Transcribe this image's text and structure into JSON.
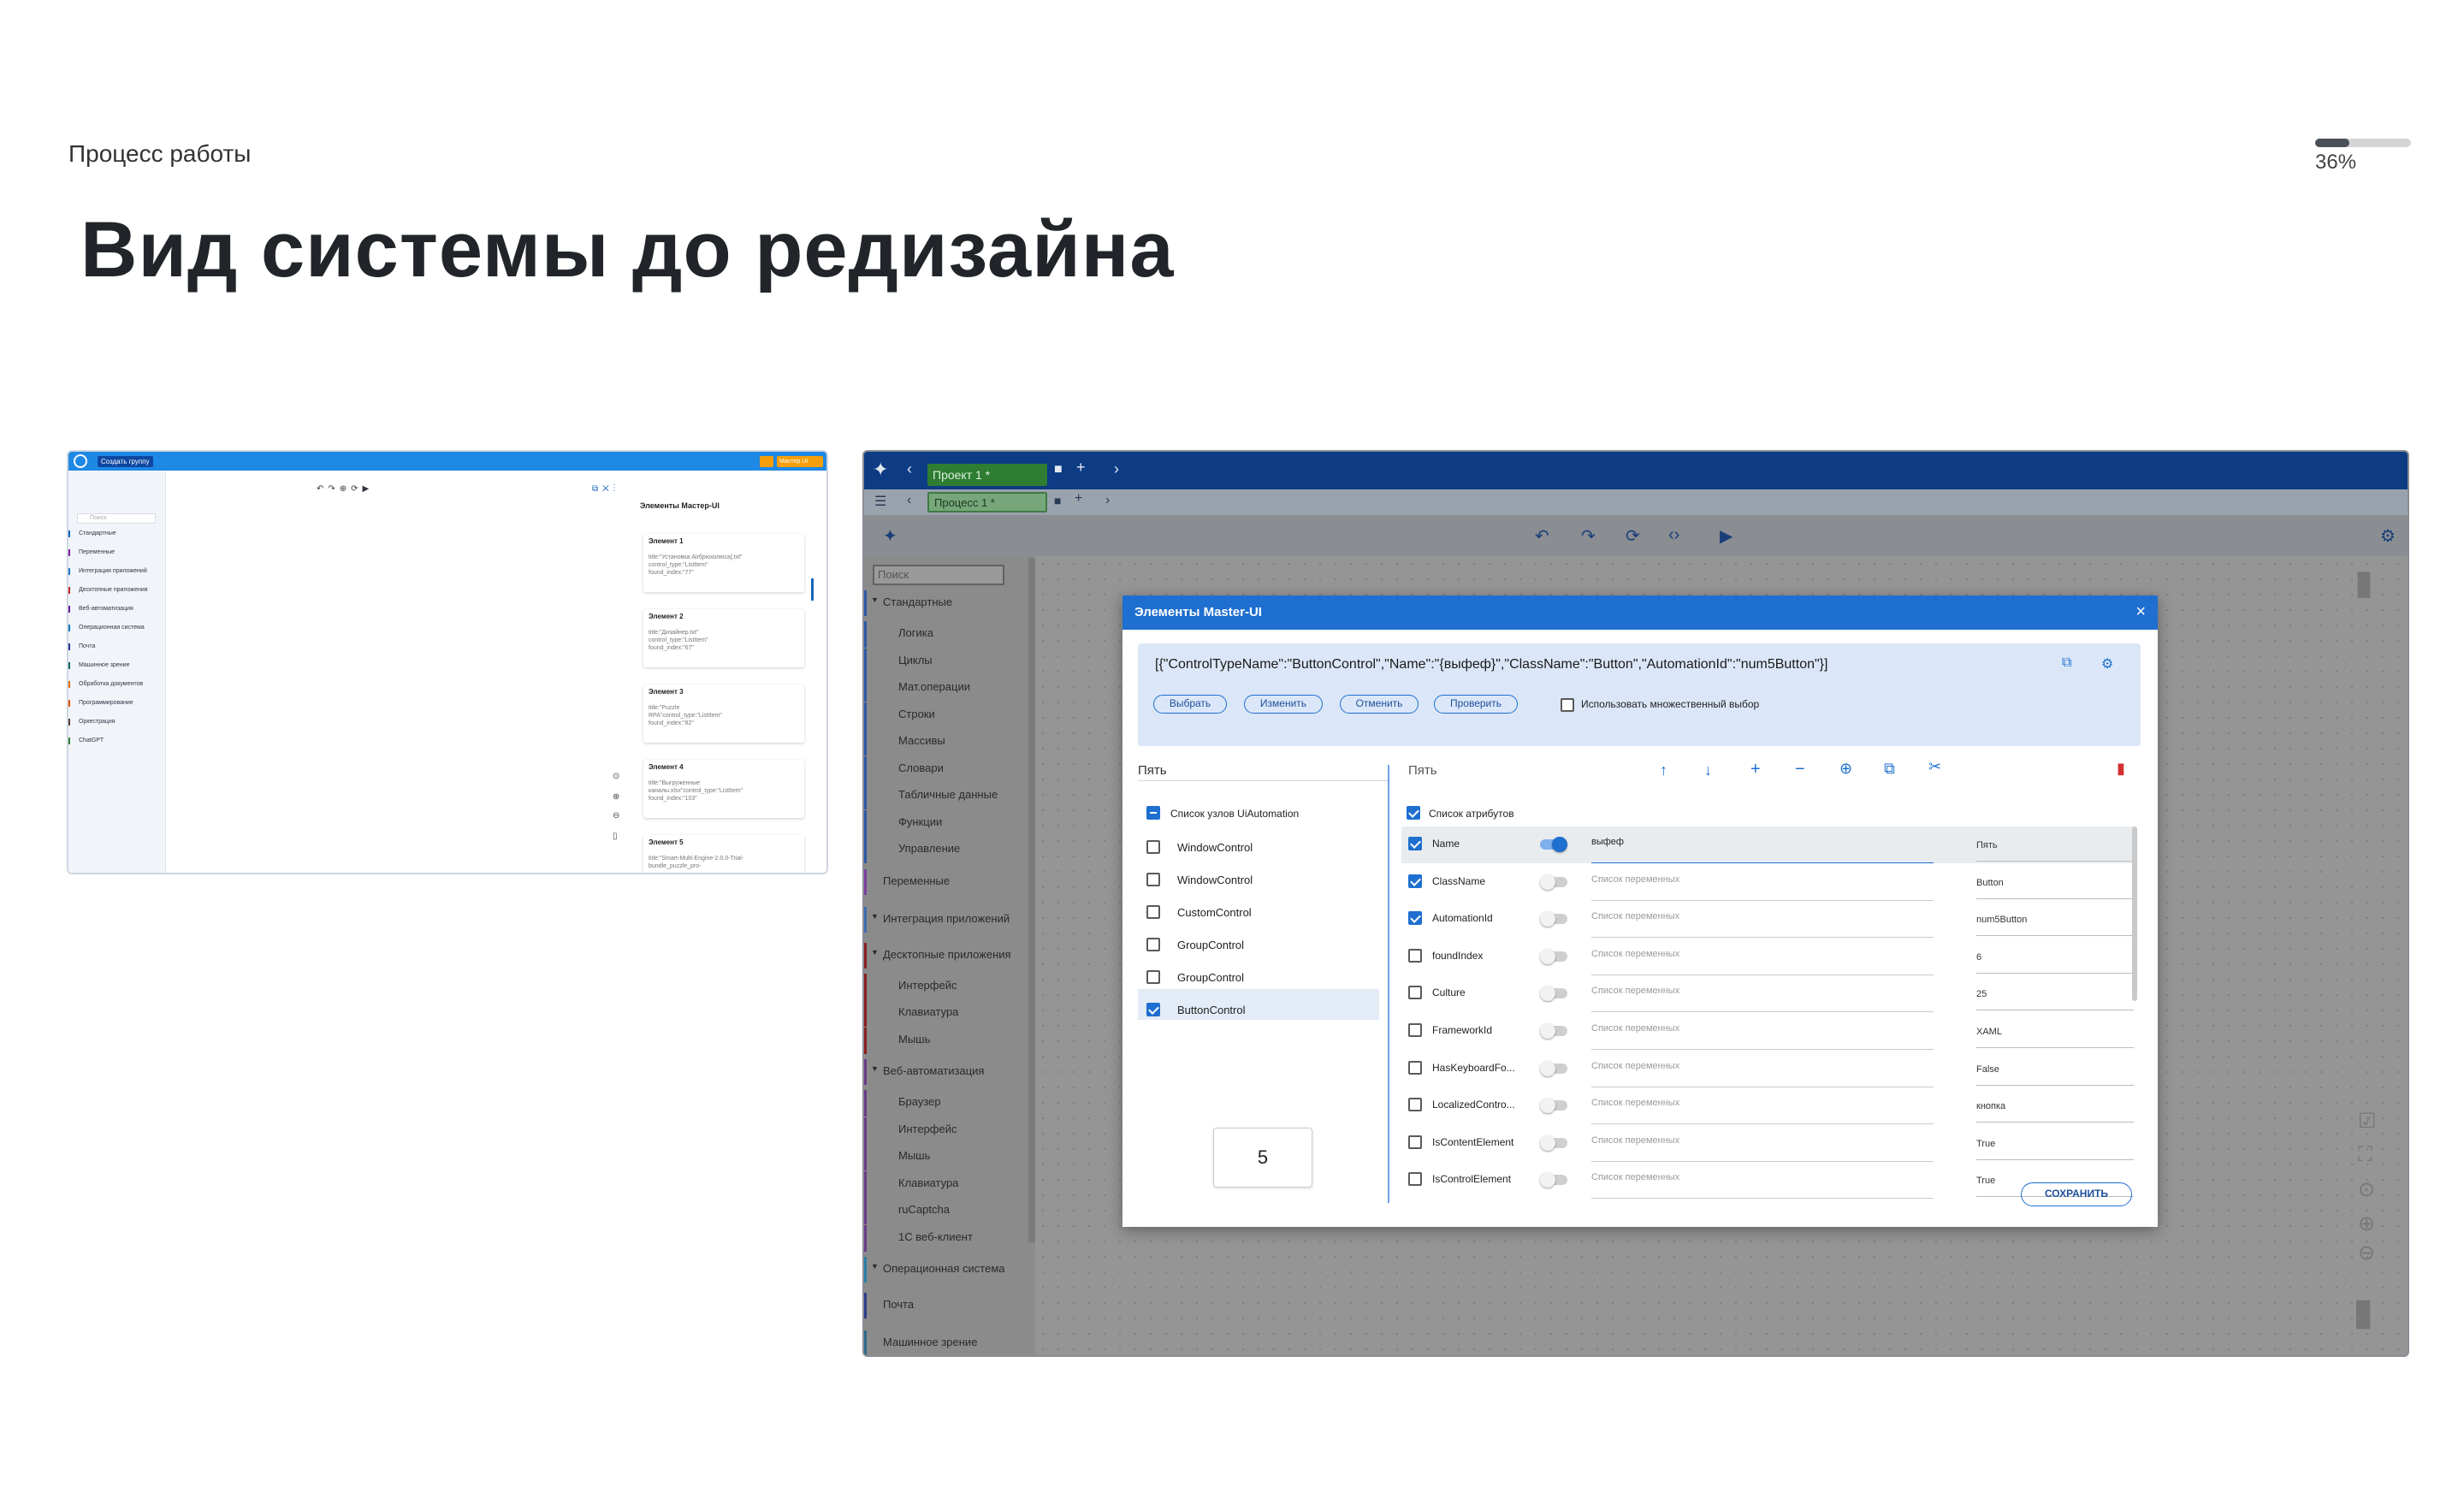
{
  "header": {
    "section": "Процесс работы",
    "title": "Вид системы до редизайна",
    "progress_value": 0.36,
    "progress_label": "36%"
  },
  "before_small": {
    "top_button": "Создать группу",
    "top_right_button": "Мастер UI",
    "search_placeholder": "Поиск",
    "categories": [
      "Стандартные",
      "Переменные",
      "Интеграция приложений",
      "Десктопные приложения",
      "Веб-автоматизация",
      "Операционная система",
      "Почта",
      "Машинное зрение",
      "Обработка документов",
      "Программирование",
      "Оркестрация",
      "ChatGPT"
    ],
    "panel_title": "Элементы Мастер-UI",
    "cards": [
      {
        "title": "Элемент 1",
        "lines": [
          "title:\"Установка Airбрюхолюса].txt\"",
          "control_type:\"ListItem\"",
          "found_index:\"77\""
        ]
      },
      {
        "title": "Элемент 2",
        "lines": [
          "title:\"Дизайнер.txt\"",
          "control_type:\"ListItem\"",
          "found_index:\"67\""
        ]
      },
      {
        "title": "Элемент 3",
        "lines": [
          "title:\"Puzzle",
          "RPA\"control_type:\"ListItem\"",
          "found_index:\"82\""
        ]
      },
      {
        "title": "Элемент 4",
        "lines": [
          "title:\"Выгруженные",
          "каналы.xlsx\"control_type:\"ListItem\"",
          "found_index:\"103\""
        ]
      },
      {
        "title": "Элемент 5",
        "lines": [
          "title:\"Smart-Multi-Engine-2.0.0-Trial-",
          "bundle_puzzle_pro-"
        ]
      }
    ]
  },
  "before_large": {
    "project_tab": "Проект 1 *",
    "process_tab": "Процесс 1 *",
    "search_placeholder": "Поиск",
    "sidebar": [
      {
        "label": "Стандартные",
        "kind": "group",
        "color": "#2e5aa8"
      },
      {
        "label": "Логика",
        "kind": "sub",
        "color": "#2e5aa8"
      },
      {
        "label": "Циклы",
        "kind": "sub",
        "color": "#2e5aa8"
      },
      {
        "label": "Мат.операции",
        "kind": "sub",
        "color": "#2e5aa8"
      },
      {
        "label": "Строки",
        "kind": "sub",
        "color": "#2e5aa8"
      },
      {
        "label": "Массивы",
        "kind": "sub",
        "color": "#2e5aa8"
      },
      {
        "label": "Словари",
        "kind": "sub",
        "color": "#2e5aa8"
      },
      {
        "label": "Табличные данные",
        "kind": "sub",
        "color": "#2e5aa8"
      },
      {
        "label": "Функции",
        "kind": "sub",
        "color": "#2e5aa8"
      },
      {
        "label": "Управление",
        "kind": "sub",
        "color": "#2e5aa8"
      },
      {
        "label": "Переменные",
        "kind": "single",
        "color": "#7b3fa0"
      },
      {
        "label": "Интеграция приложений",
        "kind": "group",
        "color": "#3a6fb0"
      },
      {
        "label": "Десктопные приложения",
        "kind": "group",
        "color": "#8a1f1f"
      },
      {
        "label": "Интерфейс",
        "kind": "sub",
        "color": "#8a1f1f"
      },
      {
        "label": "Клавиатура",
        "kind": "sub",
        "color": "#8a1f1f"
      },
      {
        "label": "Мышь",
        "kind": "sub",
        "color": "#8a1f1f"
      },
      {
        "label": "Веб-автоматизация",
        "kind": "group",
        "color": "#6b3b8a"
      },
      {
        "label": "Браузер",
        "kind": "sub",
        "color": "#6b3b8a"
      },
      {
        "label": "Интерфейс",
        "kind": "sub",
        "color": "#6b3b8a"
      },
      {
        "label": "Мышь",
        "kind": "sub",
        "color": "#6b3b8a"
      },
      {
        "label": "Клавиатура",
        "kind": "sub",
        "color": "#6b3b8a"
      },
      {
        "label": "ruCaptcha",
        "kind": "sub",
        "color": "#6b3b8a"
      },
      {
        "label": "1С веб-клиент",
        "kind": "sub",
        "color": "#6b3b8a"
      },
      {
        "label": "Операционная система",
        "kind": "group",
        "color": "#2a7fa8"
      },
      {
        "label": "Почта",
        "kind": "single",
        "color": "#2d3c8a"
      },
      {
        "label": "Машинное зрение",
        "kind": "single",
        "color": "#2d6a8a"
      }
    ],
    "modal": {
      "title": "Элементы Master-UI",
      "selector_json": "[{\"ControlTypeName\":\"ButtonControl\",\"Name\":\"{выфеф}\",\"ClassName\":\"Button\",\"AutomationId\":\"num5Button\"}]",
      "buttons": [
        "Выбрать",
        "Изменить",
        "Отменить",
        "Проверить"
      ],
      "multi_select_label": "Использовать множественный выбор",
      "left_header": "Пять",
      "right_header": "Пять",
      "nodes_title": "Список узлов UiAutomation",
      "nodes": [
        {
          "label": "WindowControl",
          "checked": false
        },
        {
          "label": "WindowControl",
          "checked": false
        },
        {
          "label": "CustomControl",
          "checked": false
        },
        {
          "label": "GroupControl",
          "checked": false
        },
        {
          "label": "GroupControl",
          "checked": false
        },
        {
          "label": "ButtonControl",
          "checked": true
        }
      ],
      "preview_value": "5",
      "attrs_title": "Список атрибутов",
      "attrs": [
        {
          "name": "Name",
          "checked": true,
          "toggle": true,
          "var": "выфеф",
          "value": "Пять"
        },
        {
          "name": "ClassName",
          "checked": true,
          "toggle": false,
          "var": "Список переменных",
          "value": "Button"
        },
        {
          "name": "AutomationId",
          "checked": true,
          "toggle": false,
          "var": "Список переменных",
          "value": "num5Button"
        },
        {
          "name": "foundIndex",
          "checked": false,
          "toggle": false,
          "var": "Список переменных",
          "value": "6"
        },
        {
          "name": "Culture",
          "checked": false,
          "toggle": false,
          "var": "Список переменных",
          "value": "25"
        },
        {
          "name": "FrameworkId",
          "checked": false,
          "toggle": false,
          "var": "Список переменных",
          "value": "XAML"
        },
        {
          "name": "HasKeyboardFo...",
          "checked": false,
          "toggle": false,
          "var": "Список переменных",
          "value": "False"
        },
        {
          "name": "LocalizedContro...",
          "checked": false,
          "toggle": false,
          "var": "Список переменных",
          "value": "кнопка"
        },
        {
          "name": "IsContentElement",
          "checked": false,
          "toggle": false,
          "var": "Список переменных",
          "value": "True"
        },
        {
          "name": "IsControlElement",
          "checked": false,
          "toggle": false,
          "var": "Список переменных",
          "value": "True"
        }
      ],
      "save_label": "СОХРАНИТЬ"
    }
  }
}
